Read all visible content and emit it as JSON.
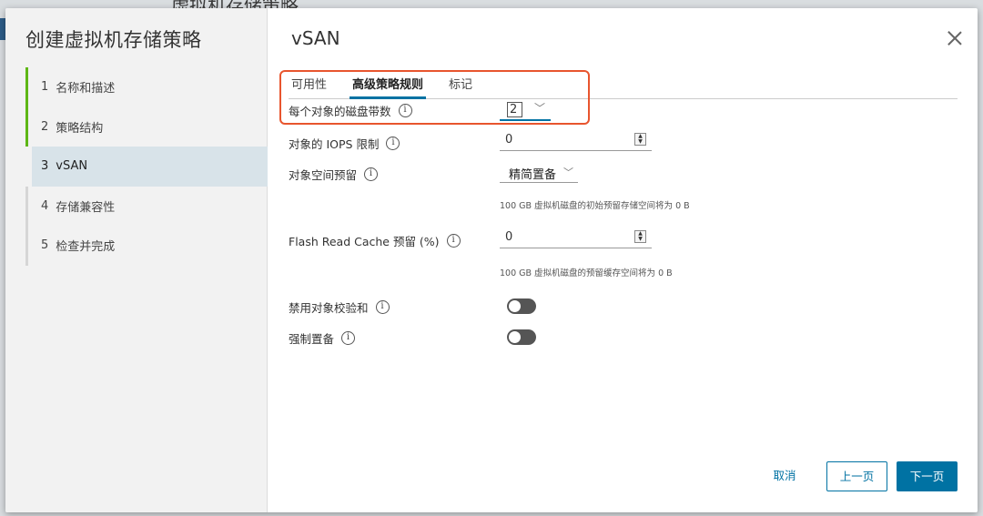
{
  "background": {
    "title": "虚拟机存储策略"
  },
  "wizard": {
    "title": "创建虚拟机存储策略",
    "steps": [
      {
        "num": "1",
        "label": "名称和描述"
      },
      {
        "num": "2",
        "label": "策略结构"
      },
      {
        "num": "3",
        "label": "vSAN"
      },
      {
        "num": "4",
        "label": "存储兼容性"
      },
      {
        "num": "5",
        "label": "检查并完成"
      }
    ]
  },
  "page": {
    "title": "vSAN",
    "tabs": [
      "可用性",
      "高级策略规则",
      "标记"
    ],
    "active_tab": "高级策略规则"
  },
  "rules": {
    "stripes": {
      "label": "每个对象的磁盘带数",
      "value": "2"
    },
    "iops": {
      "label": "对象的 IOPS 限制",
      "value": "0"
    },
    "space_reservation": {
      "label": "对象空间预留",
      "value": "精简置备",
      "hint": "100 GB 虚拟机磁盘的初始预留存储空间将为 0 B"
    },
    "flash_cache": {
      "label": "Flash Read Cache 预留 (%)",
      "value": "0",
      "hint": "100 GB 虚拟机磁盘的预留缓存空间将为 0 B"
    },
    "disable_checksum": {
      "label": "禁用对象校验和",
      "enabled": false
    },
    "force_provisioning": {
      "label": "强制置备",
      "enabled": false
    }
  },
  "footer": {
    "cancel": "取消",
    "back": "上一页",
    "next": "下一页"
  },
  "colors": {
    "accent": "#0072a3",
    "highlight": "#e8552e",
    "done": "#5eb715"
  }
}
